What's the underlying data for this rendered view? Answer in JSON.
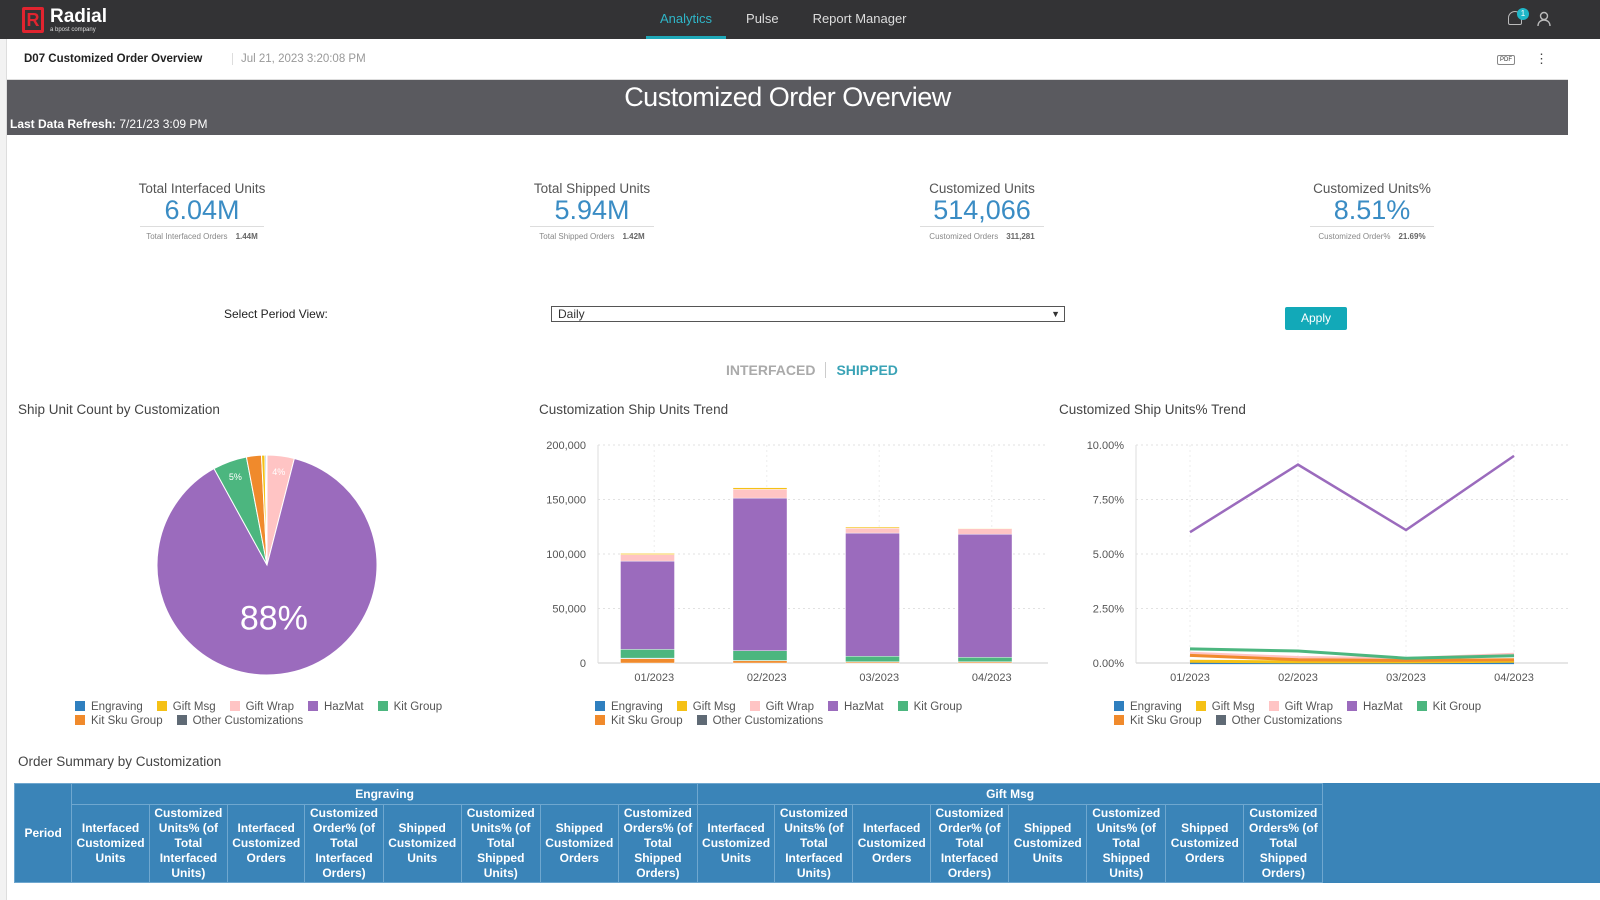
{
  "nav": {
    "brand": "Radial",
    "brand_sub": "a bpost company",
    "tabs": [
      {
        "label": "Analytics",
        "active": true
      },
      {
        "label": "Pulse"
      },
      {
        "label": "Report Manager"
      }
    ],
    "notification_count": "1"
  },
  "subheader": {
    "title": "D07 Customized Order Overview",
    "date": "Jul 21, 2023 3:20:08 PM",
    "pdf_label": "PDF"
  },
  "banner": {
    "title": "Customized Order Overview",
    "refresh_label": "Last Data Refresh:",
    "refresh_value": "7/21/23 3:09 PM"
  },
  "kpis": [
    {
      "label": "Total Interfaced Units",
      "value": "6.04M",
      "sub_label": "Total Interfaced Orders",
      "sub_value": "1.44M"
    },
    {
      "label": "Total Shipped Units",
      "value": "5.94M",
      "sub_label": "Total Shipped Orders",
      "sub_value": "1.42M"
    },
    {
      "label": "Customized Units",
      "value": "514,066",
      "sub_label": "Customized Orders",
      "sub_value": "311,281"
    },
    {
      "label": "Customized Units%",
      "value": "8.51%",
      "sub_label": "Customized Order%",
      "sub_value": "21.69%"
    }
  ],
  "filter": {
    "label": "Select Period View:",
    "selected": "Daily",
    "apply": "Apply"
  },
  "toggle": {
    "interfaced": "INTERFACED",
    "shipped": "SHIPPED",
    "active": "SHIPPED"
  },
  "colors": {
    "Engraving": "#2f7fbf",
    "Gift Msg": "#f5c116",
    "Gift Wrap": "#ffc4c4",
    "HazMat": "#9b6bbd",
    "Kit Group": "#4cb67f",
    "Kit Sku Group": "#f08a2c",
    "Other Customizations": "#5f6a75"
  },
  "legend": [
    "Engraving",
    "Gift Msg",
    "Gift Wrap",
    "HazMat",
    "Kit Group",
    "Kit Sku Group",
    "Other Customizations"
  ],
  "chart_data": [
    {
      "type": "pie",
      "title": "Ship Unit Count by Customization",
      "slices": [
        {
          "name": "Gift Wrap",
          "value": 4,
          "label": "4%"
        },
        {
          "name": "HazMat",
          "value": 88,
          "label": "88%"
        },
        {
          "name": "Kit Group",
          "value": 5,
          "label": "5%"
        },
        {
          "name": "Kit Sku Group",
          "value": 2.2
        },
        {
          "name": "Gift Msg",
          "value": 0.5
        },
        {
          "name": "Engraving",
          "value": 0.2
        },
        {
          "name": "Other Customizations",
          "value": 0.1
        }
      ]
    },
    {
      "type": "bar",
      "stacked": true,
      "title": "Customization Ship Units Trend",
      "categories": [
        "01/2023",
        "02/2023",
        "03/2023",
        "04/2023"
      ],
      "ylim": [
        0,
        200000
      ],
      "yticks": [
        "0",
        "50,000",
        "100,000",
        "150,000",
        "200,000"
      ],
      "grid": true,
      "legend": "bottom",
      "series": [
        {
          "name": "Other Customizations",
          "values": [
            0,
            0,
            0,
            0
          ]
        },
        {
          "name": "Kit Sku Group",
          "values": [
            4000,
            2000,
            1000,
            1000
          ]
        },
        {
          "name": "Engraving",
          "values": [
            500,
            300,
            200,
            200
          ]
        },
        {
          "name": "Kit Group",
          "values": [
            8000,
            9000,
            5000,
            4000
          ]
        },
        {
          "name": "HazMat",
          "values": [
            81000,
            140000,
            113000,
            113000
          ]
        },
        {
          "name": "Gift Wrap",
          "values": [
            6000,
            8000,
            4500,
            5000
          ]
        },
        {
          "name": "Gift Msg",
          "values": [
            1000,
            1500,
            1000,
            300
          ]
        }
      ]
    },
    {
      "type": "line",
      "title": "Customized Ship Units% Trend",
      "categories": [
        "01/2023",
        "02/2023",
        "03/2023",
        "04/2023"
      ],
      "ylim": [
        0,
        10
      ],
      "yticks": [
        "0.00%",
        "2.50%",
        "5.00%",
        "7.50%",
        "10.00%"
      ],
      "grid": true,
      "legend": "bottom",
      "series": [
        {
          "name": "Engraving",
          "values": [
            0.02,
            0.02,
            0.02,
            0.02
          ]
        },
        {
          "name": "Gift Msg",
          "values": [
            0.08,
            0.05,
            0.05,
            0.08
          ]
        },
        {
          "name": "Gift Wrap",
          "values": [
            0.45,
            0.25,
            0.2,
            0.4
          ]
        },
        {
          "name": "Kit Sku Group",
          "values": [
            0.35,
            0.15,
            0.12,
            0.15
          ]
        },
        {
          "name": "Kit Group",
          "values": [
            0.65,
            0.55,
            0.22,
            0.33
          ]
        },
        {
          "name": "HazMat",
          "values": [
            6.0,
            9.1,
            6.1,
            9.5
          ]
        }
      ]
    }
  ],
  "summary": {
    "title": "Order Summary by Customization",
    "period_header": "Period",
    "groups": [
      "Engraving",
      "Gift Msg"
    ],
    "columns": [
      "Interfaced Customized Units",
      "Customized Units% (of Total Interfaced Units)",
      "Interfaced Customized Orders",
      "Customized Order% (of Total Interfaced Orders)",
      "Shipped Customized Units",
      "Customized Units% (of Total Shipped Units)",
      "Shipped Customized Orders",
      "Customized Orders% (of Total Shipped Orders)"
    ]
  }
}
